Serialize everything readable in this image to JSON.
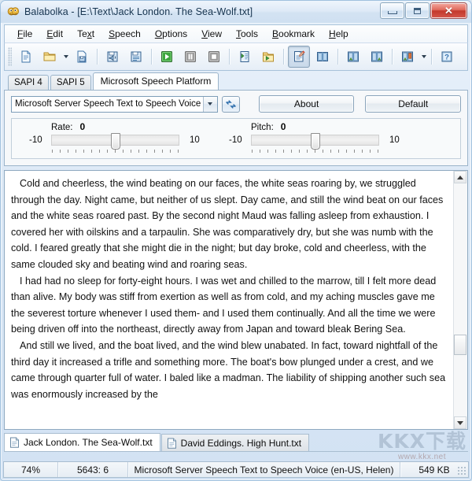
{
  "window": {
    "title": "Balabolka - [E:\\Text\\Jack London. The Sea-Wolf.txt]",
    "app_icon": "balabolka-icon",
    "buttons": {
      "minimize": "minimize-button",
      "maximize": "maximize-button",
      "close": "close-button"
    }
  },
  "menubar": {
    "items": [
      {
        "label": "File",
        "accel": "F"
      },
      {
        "label": "Edit",
        "accel": "E"
      },
      {
        "label": "Text",
        "accel": "x"
      },
      {
        "label": "Speech",
        "accel": "S"
      },
      {
        "label": "Options",
        "accel": "O"
      },
      {
        "label": "View",
        "accel": "V"
      },
      {
        "label": "Tools",
        "accel": "T"
      },
      {
        "label": "Bookmark",
        "accel": "B"
      },
      {
        "label": "Help",
        "accel": "H"
      }
    ]
  },
  "toolbar": {
    "buttons": [
      {
        "name": "new-document-button",
        "icon": "new-document-icon",
        "pressed": false
      },
      {
        "name": "open-file-button",
        "icon": "open-folder-icon",
        "pressed": false
      },
      {
        "name": "open-file-dropdown",
        "icon": "chevron-down-icon",
        "pressed": false
      },
      {
        "name": "save-file-button",
        "icon": "save-document-icon",
        "pressed": false
      },
      {
        "name": "sep-1",
        "icon": "separator",
        "pressed": false
      },
      {
        "name": "save-audio-file-button",
        "icon": "save-audio-icon",
        "pressed": false
      },
      {
        "name": "split-audio-file-button",
        "icon": "split-audio-icon",
        "pressed": false
      },
      {
        "name": "sep-2",
        "icon": "separator",
        "pressed": false
      },
      {
        "name": "play-button",
        "icon": "play-icon",
        "pressed": false
      },
      {
        "name": "pause-button",
        "icon": "pause-icon",
        "pressed": false
      },
      {
        "name": "stop-button",
        "icon": "stop-icon",
        "pressed": false
      },
      {
        "name": "sep-3",
        "icon": "separator",
        "pressed": false
      },
      {
        "name": "read-clipboard-button",
        "icon": "clipboard-play-icon",
        "pressed": false
      },
      {
        "name": "read-folder-button",
        "icon": "folder-play-icon",
        "pressed": false
      },
      {
        "name": "sep-4",
        "icon": "separator",
        "pressed": false
      },
      {
        "name": "edit-text-button",
        "icon": "edit-document-icon",
        "pressed": true
      },
      {
        "name": "two-page-view-button",
        "icon": "book-open-icon",
        "pressed": false
      },
      {
        "name": "sep-5",
        "icon": "separator",
        "pressed": false
      },
      {
        "name": "add-bookmark-button",
        "icon": "bookmark-add-icon",
        "pressed": false
      },
      {
        "name": "goto-bookmark-button",
        "icon": "bookmark-goto-icon",
        "pressed": false
      },
      {
        "name": "sep-6",
        "icon": "separator",
        "pressed": false
      },
      {
        "name": "bookmark-list-button",
        "icon": "bookmark-list-icon",
        "pressed": false
      },
      {
        "name": "bookmark-list-dropdown",
        "icon": "chevron-down-icon",
        "pressed": false
      },
      {
        "name": "sep-7",
        "icon": "separator",
        "pressed": false
      },
      {
        "name": "help-button",
        "icon": "help-icon",
        "pressed": false
      }
    ]
  },
  "engine_tabs": {
    "items": [
      {
        "label": "SAPI 4",
        "active": false
      },
      {
        "label": "SAPI 5",
        "active": false
      },
      {
        "label": "Microsoft Speech Platform",
        "active": true
      }
    ]
  },
  "settings": {
    "voice_combo": {
      "value": "Microsoft Server Speech Text to Speech Voice (e",
      "arrow_icon": "chevron-down-icon"
    },
    "refresh_button": {
      "label": "",
      "icon": "refresh-icon"
    },
    "about_button": "About",
    "default_button": "Default",
    "rate": {
      "label": "Rate:",
      "value": "0",
      "min": "-10",
      "max": "10",
      "position_pct": 50
    },
    "pitch": {
      "label": "Pitch:",
      "value": "0",
      "min": "-10",
      "max": "10",
      "position_pct": 50
    }
  },
  "editor": {
    "paragraphs": [
      "Cold and cheerless, the wind beating on our faces, the white seas roaring by, we struggled through the day. Night came, but neither of us slept. Day came, and still the wind beat on our faces and the white seas roared past. By the second night Maud was falling asleep from exhaustion. I covered her with oilskins and a tarpaulin. She was comparatively dry, but she was numb with the cold. I feared greatly that she might die in the night; but day broke, cold and cheerless, with the same clouded sky and beating wind and roaring seas.",
      "I had had no sleep for forty-eight hours. I was wet and chilled to the marrow, till I felt more dead than alive. My body was stiff from exertion as well as from cold, and my aching muscles gave me the severest torture whenever I used them- and I used them continually. And all the time we were being driven off into the northeast, directly away from Japan and toward bleak Bering Sea.",
      "And still we lived, and the boat lived, and the wind blew unabated. In fact, toward nightfall of the third day it increased a trifle and something more. The boat's bow plunged under a crest, and we came through quarter full of water. I baled like a madman. The liability of shipping another such sea was enormously increased by the"
    ],
    "scrollbar": {
      "up_icon": "scroll-up-arrow-icon",
      "down_icon": "scroll-down-arrow-icon"
    }
  },
  "file_tabs": {
    "items": [
      {
        "label": "Jack London. The Sea-Wolf.txt",
        "active": true,
        "icon": "document-icon"
      },
      {
        "label": "David Eddings. High Hunt.txt",
        "active": false,
        "icon": "document-icon"
      }
    ]
  },
  "statusbar": {
    "percent": "74%",
    "position": "5643:  6",
    "voice": "Microsoft Server Speech Text to Speech Voice (en-US, Helen)",
    "filesize": "549 KB"
  },
  "watermark": {
    "main": "KKX下载",
    "sub": "www.kkx.net"
  },
  "colors": {
    "accent": "#2f6fad",
    "titlebar": "#d3e2f2",
    "close_red": "#c3392c",
    "panel_bg": "#f6f8fa",
    "editor_bg": "#ffffff"
  }
}
